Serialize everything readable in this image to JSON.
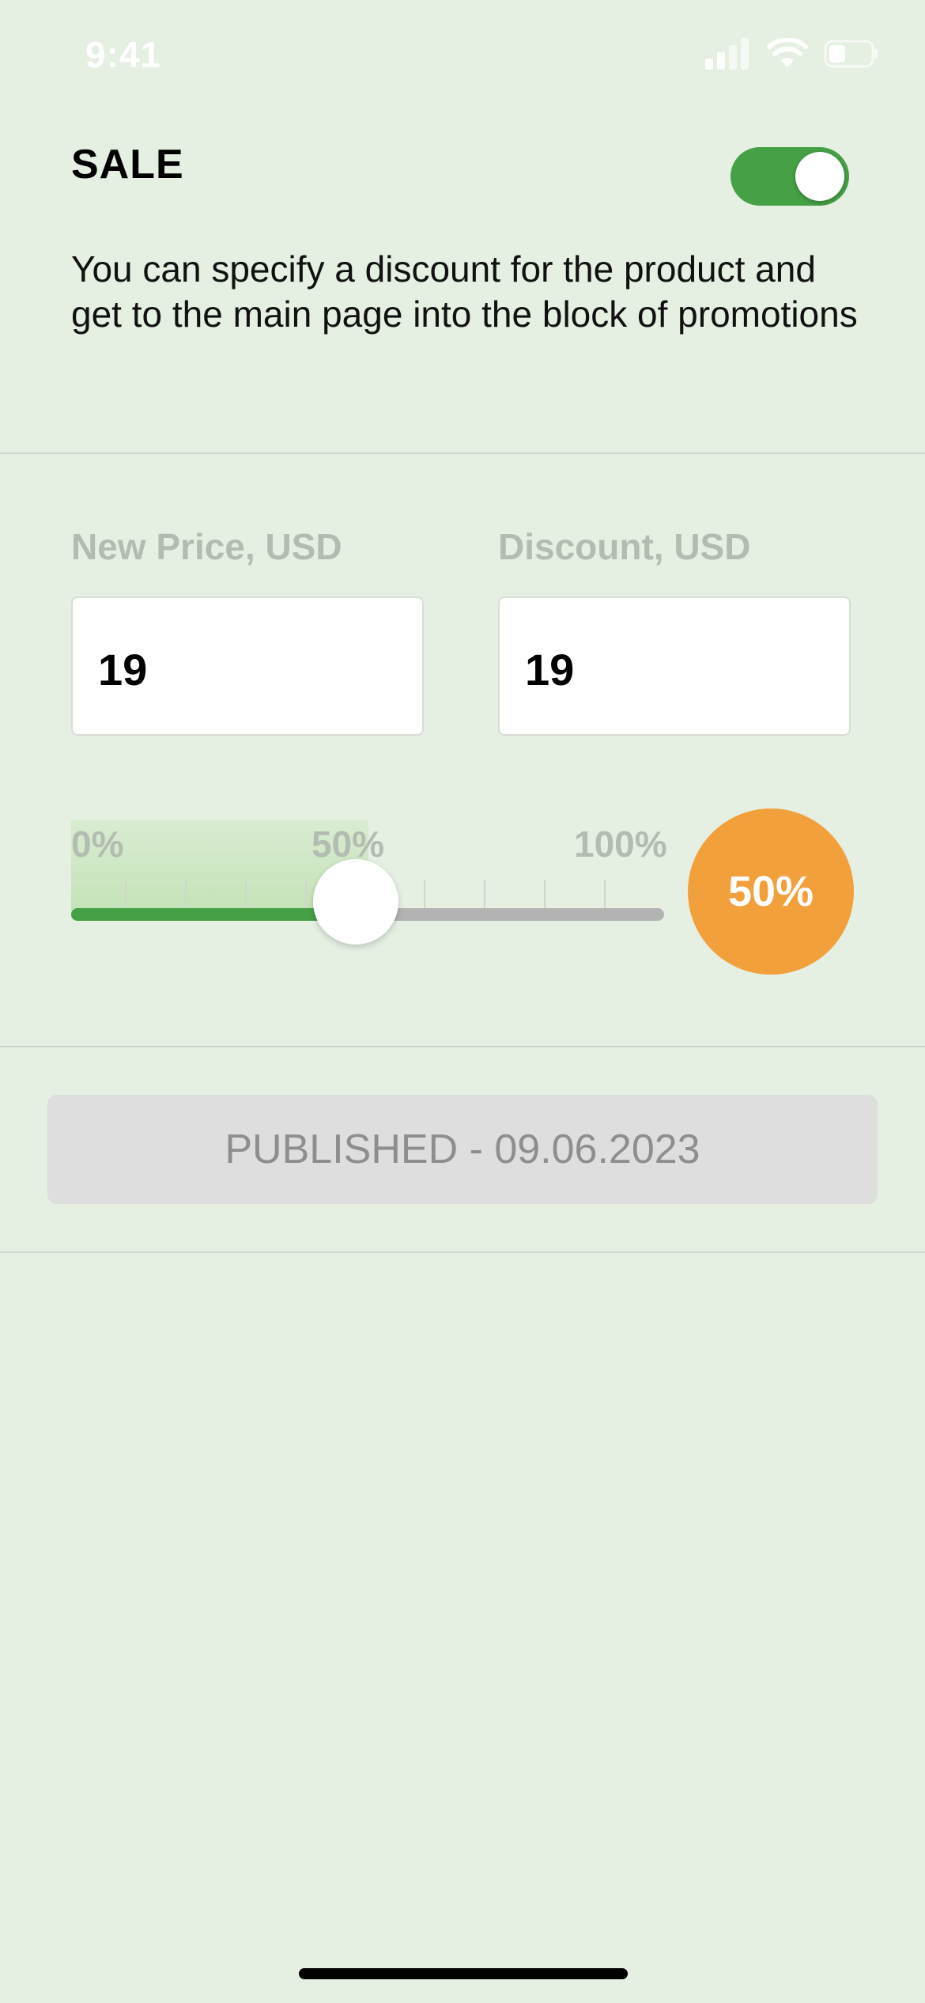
{
  "status_bar": {
    "time": "9:41",
    "icons": [
      "cellular-signal-icon",
      "wifi-icon",
      "battery-icon"
    ]
  },
  "sale": {
    "title": "SALE",
    "toggle_on": true,
    "description": "You can specify a discount for the product and get to the main page into the block of promotions"
  },
  "fields": {
    "new_price": {
      "label": "New Price, USD",
      "value": "19"
    },
    "discount": {
      "label": "Discount, USD",
      "value": "19"
    }
  },
  "slider": {
    "labels": {
      "min": "0%",
      "mid": "50%",
      "max": "100%"
    },
    "value_percent": 50,
    "badge": "50%"
  },
  "publish": {
    "label": "PUBLISHED - 09.06.2023"
  },
  "colors": {
    "background": "#e5efe2",
    "accent_green": "#46a046",
    "badge_orange": "#f2a03c",
    "disabled_gray": "#dedede"
  }
}
